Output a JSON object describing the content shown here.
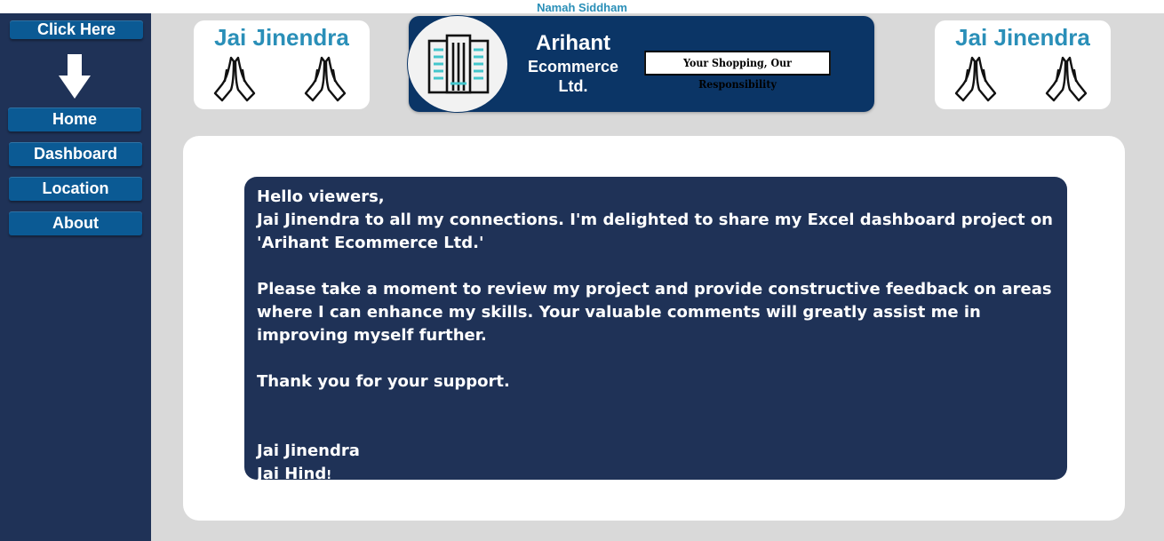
{
  "header": {
    "top_title": "Namah Siddham"
  },
  "sidebar": {
    "click_here": "Click Here",
    "items": [
      {
        "label": "Home"
      },
      {
        "label": "Dashboard"
      },
      {
        "label": "Location"
      },
      {
        "label": "About"
      }
    ]
  },
  "greeting_cards": {
    "left": {
      "title": "Jai Jinendra"
    },
    "right": {
      "title": "Jai Jinendra"
    }
  },
  "brand": {
    "name_line1": "Arihant",
    "name_line2": "Ecommerce",
    "name_line3": "Ltd.",
    "tagline": "Your Shopping, Our Responsibility"
  },
  "message": {
    "line1": "Hello viewers,",
    "line2": "Jai Jinendra to all my connections. I'm delighted to share my Excel dashboard project on 'Arihant Ecommerce Ltd.'",
    "line3": "Please take a moment to review my project and provide constructive feedback on areas where I can enhance my skills. Your valuable comments will greatly assist me in improving myself further.",
    "line4": "Thank you for your support.",
    "sign1": "Jai Jinendra",
    "sign2": "Jai Hind",
    "sign2_end": "!"
  },
  "colors": {
    "sidebar_bg": "#1f3257",
    "button_bg": "#0b5a94",
    "accent_teal": "#2a8fb8",
    "banner_bg": "#0b3566",
    "page_bg": "#d9d9d9"
  },
  "icons": {
    "down_arrow": "arrow-down-icon",
    "hands": "folded-hands-icon",
    "building": "building-icon"
  }
}
